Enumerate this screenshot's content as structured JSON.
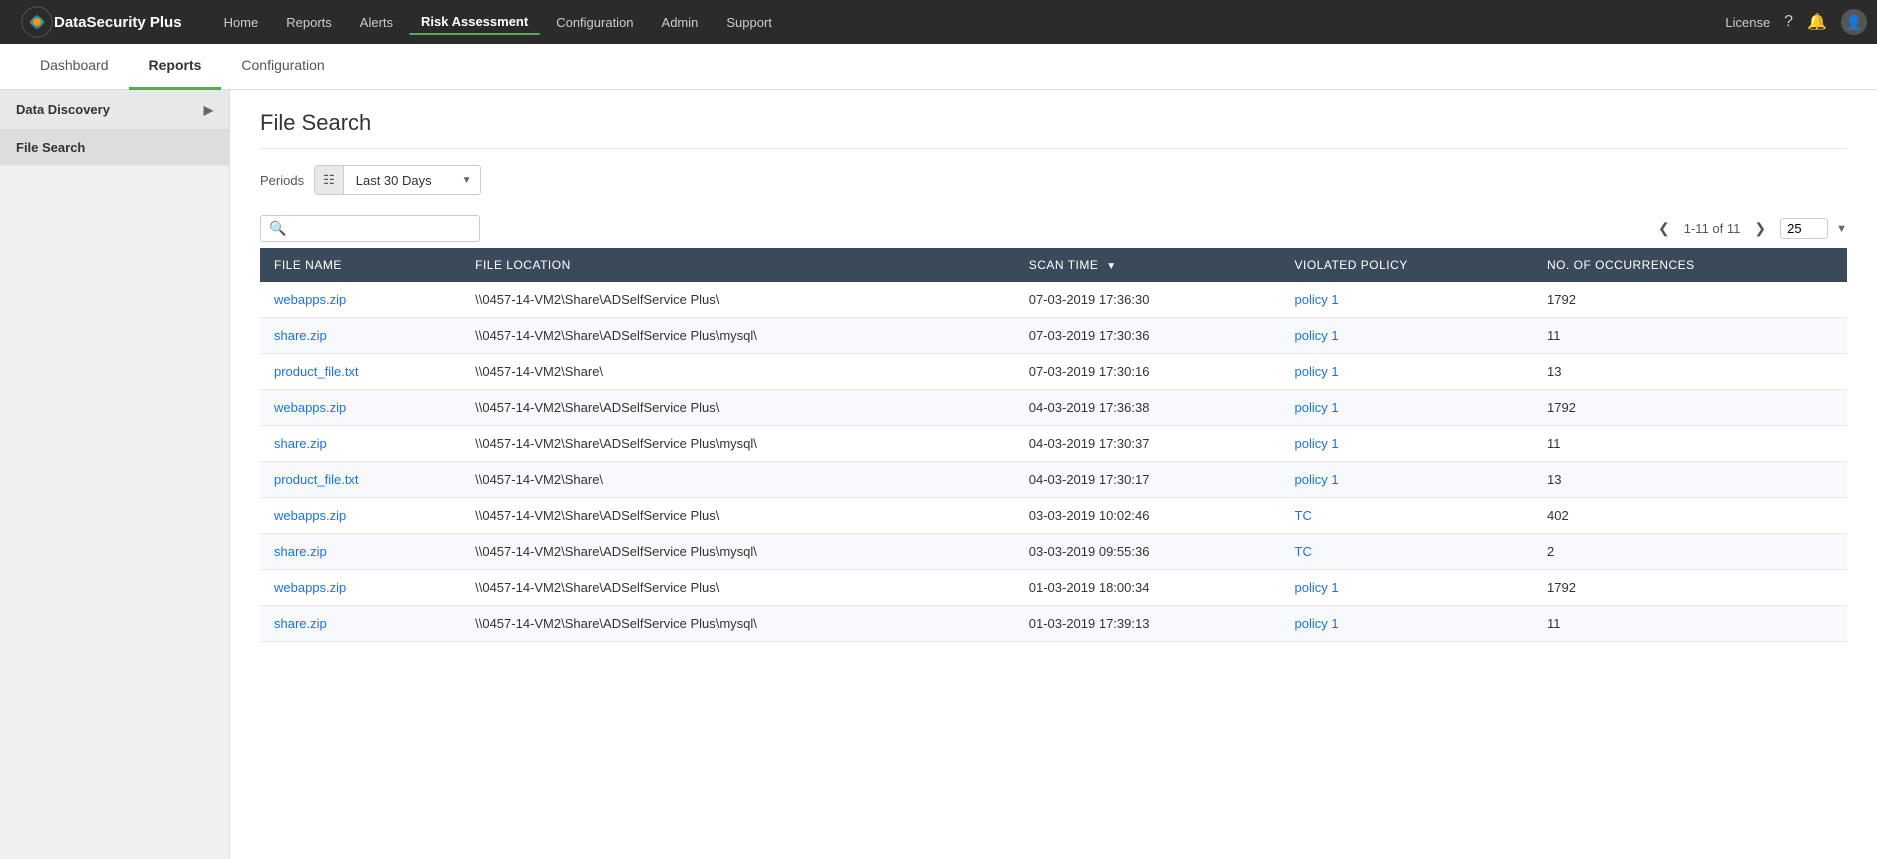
{
  "brand": {
    "name": "DataSecurity Plus"
  },
  "topNav": {
    "links": [
      {
        "id": "home",
        "label": "Home",
        "active": false
      },
      {
        "id": "reports",
        "label": "Reports",
        "active": false
      },
      {
        "id": "alerts",
        "label": "Alerts",
        "active": false
      },
      {
        "id": "risk-assessment",
        "label": "Risk Assessment",
        "active": true
      },
      {
        "id": "configuration",
        "label": "Configuration",
        "active": false
      },
      {
        "id": "admin",
        "label": "Admin",
        "active": false
      },
      {
        "id": "support",
        "label": "Support",
        "active": false
      }
    ],
    "right": {
      "license": "License",
      "help": "?",
      "bell": "🔔",
      "user": "👤"
    }
  },
  "secondNav": {
    "items": [
      {
        "id": "dashboard",
        "label": "Dashboard",
        "active": false
      },
      {
        "id": "reports",
        "label": "Reports",
        "active": true
      },
      {
        "id": "configuration",
        "label": "Configuration",
        "active": false
      }
    ]
  },
  "sidebar": {
    "section": "Data Discovery",
    "items": [
      {
        "id": "file-search",
        "label": "File Search",
        "active": true
      }
    ]
  },
  "mainContent": {
    "pageTitle": "File Search",
    "periods": {
      "label": "Periods",
      "value": "Last 30 Days"
    },
    "table": {
      "pagination": {
        "range": "1-11 of 11",
        "perPage": "25"
      },
      "columns": [
        {
          "id": "file-name",
          "label": "FILE NAME",
          "sortable": false
        },
        {
          "id": "file-location",
          "label": "FILE LOCATION",
          "sortable": false
        },
        {
          "id": "scan-time",
          "label": "SCAN TIME",
          "sortable": true
        },
        {
          "id": "violated-policy",
          "label": "VIOLATED POLICY",
          "sortable": false
        },
        {
          "id": "occurrences",
          "label": "NO. OF OCCURRENCES",
          "sortable": false
        }
      ],
      "rows": [
        {
          "fileName": "webapps.zip",
          "fileLocation": "\\\\0457-14-VM2\\Share\\ADSelfService Plus\\",
          "scanTime": "07-03-2019 17:36:30",
          "violatedPolicy": "policy 1",
          "occurrences": "1792"
        },
        {
          "fileName": "share.zip",
          "fileLocation": "\\\\0457-14-VM2\\Share\\ADSelfService Plus\\mysql\\",
          "scanTime": "07-03-2019 17:30:36",
          "violatedPolicy": "policy 1",
          "occurrences": "11"
        },
        {
          "fileName": "product_file.txt",
          "fileLocation": "\\\\0457-14-VM2\\Share\\",
          "scanTime": "07-03-2019 17:30:16",
          "violatedPolicy": "policy 1",
          "occurrences": "13"
        },
        {
          "fileName": "webapps.zip",
          "fileLocation": "\\\\0457-14-VM2\\Share\\ADSelfService Plus\\",
          "scanTime": "04-03-2019 17:36:38",
          "violatedPolicy": "policy 1",
          "occurrences": "1792"
        },
        {
          "fileName": "share.zip",
          "fileLocation": "\\\\0457-14-VM2\\Share\\ADSelfService Plus\\mysql\\",
          "scanTime": "04-03-2019 17:30:37",
          "violatedPolicy": "policy 1",
          "occurrences": "11"
        },
        {
          "fileName": "product_file.txt",
          "fileLocation": "\\\\0457-14-VM2\\Share\\",
          "scanTime": "04-03-2019 17:30:17",
          "violatedPolicy": "policy 1",
          "occurrences": "13"
        },
        {
          "fileName": "webapps.zip",
          "fileLocation": "\\\\0457-14-VM2\\Share\\ADSelfService Plus\\",
          "scanTime": "03-03-2019 10:02:46",
          "violatedPolicy": "TC",
          "occurrences": "402"
        },
        {
          "fileName": "share.zip",
          "fileLocation": "\\\\0457-14-VM2\\Share\\ADSelfService Plus\\mysql\\",
          "scanTime": "03-03-2019 09:55:36",
          "violatedPolicy": "TC",
          "occurrences": "2"
        },
        {
          "fileName": "webapps.zip",
          "fileLocation": "\\\\0457-14-VM2\\Share\\ADSelfService Plus\\",
          "scanTime": "01-03-2019 18:00:34",
          "violatedPolicy": "policy 1",
          "occurrences": "1792"
        },
        {
          "fileName": "share.zip",
          "fileLocation": "\\\\0457-14-VM2\\Share\\ADSelfService Plus\\mysql\\",
          "scanTime": "01-03-2019 17:39:13",
          "violatedPolicy": "policy 1",
          "occurrences": "11"
        }
      ]
    }
  }
}
